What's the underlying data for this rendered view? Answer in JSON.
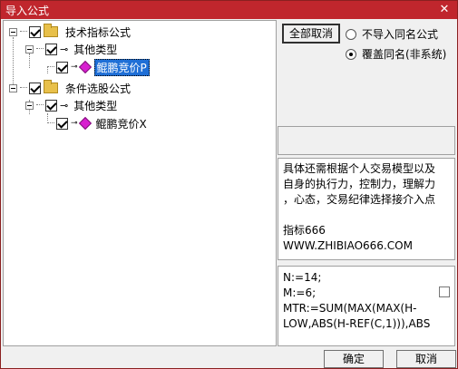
{
  "window": {
    "title": "导入公式",
    "close_glyph": "✕"
  },
  "tree": {
    "root1": {
      "label": "技术指标公式"
    },
    "root1_child": {
      "label": "其他类型"
    },
    "root1_leaf": {
      "label": "鲲鹏竞价P"
    },
    "root2": {
      "label": "条件选股公式"
    },
    "root2_child": {
      "label": "其他类型"
    },
    "root2_leaf": {
      "label": "鲲鹏竞价X"
    }
  },
  "options": {
    "cancel_all_label": "全部取消",
    "no_import_label": "不导入同名公式",
    "overwrite_label": "覆盖同名(非系统)"
  },
  "description": {
    "line1": "具体还需根据个人交易模型以及",
    "line2": "自身的执行力，控制力，理解力",
    "line3": "，心态，交易纪律选择接介入点",
    "line4": "指标666",
    "line5": "WWW.ZHIBIAO666.COM"
  },
  "code": {
    "line1": "N:=14;",
    "line2": "M:=6;",
    "line3": "MTR:=SUM(MAX(MAX(H-",
    "line4": "LOW,ABS(H-REF(C,1))),ABS"
  },
  "footer": {
    "ok_label": "确定",
    "cancel_label": "取消"
  }
}
